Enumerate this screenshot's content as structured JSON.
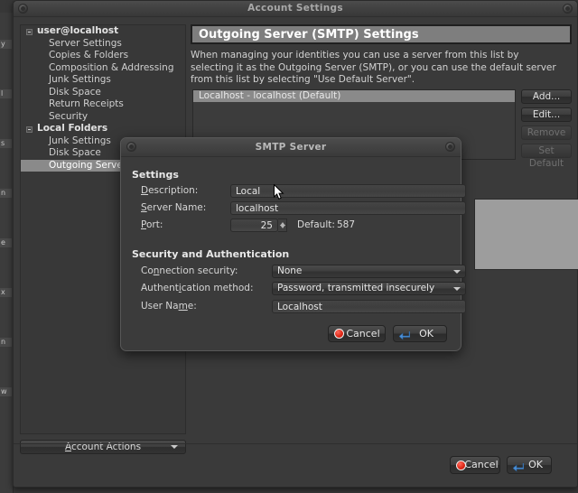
{
  "window": {
    "title": "Account Settings"
  },
  "sidebar": {
    "items": [
      {
        "label": "user@localhost",
        "level": "root",
        "selected": false,
        "twisty": true
      },
      {
        "label": "Server Settings",
        "level": "child",
        "selected": false,
        "twisty": false
      },
      {
        "label": "Copies & Folders",
        "level": "child",
        "selected": false,
        "twisty": false
      },
      {
        "label": "Composition & Addressing",
        "level": "child",
        "selected": false,
        "twisty": false
      },
      {
        "label": "Junk Settings",
        "level": "child",
        "selected": false,
        "twisty": false
      },
      {
        "label": "Disk Space",
        "level": "child",
        "selected": false,
        "twisty": false
      },
      {
        "label": "Return Receipts",
        "level": "child",
        "selected": false,
        "twisty": false
      },
      {
        "label": "Security",
        "level": "child",
        "selected": false,
        "twisty": false
      },
      {
        "label": "Local Folders",
        "level": "root",
        "selected": false,
        "twisty": true
      },
      {
        "label": "Junk Settings",
        "level": "child",
        "selected": false,
        "twisty": false
      },
      {
        "label": "Disk Space",
        "level": "child",
        "selected": false,
        "twisty": false
      },
      {
        "label": "Outgoing Server (SMTP)",
        "level": "child",
        "selected": true,
        "twisty": false
      }
    ],
    "account_actions_label": "Account Actions"
  },
  "content": {
    "pane_title": "Outgoing Server (SMTP) Settings",
    "description": "When managing your identities you can use a server from this list by selecting it as the Outgoing Server (SMTP), or you can use the default server from this list by selecting \"Use Default Server\".",
    "server_list": [
      {
        "label": "Localhost - localhost (Default)",
        "selected": true
      }
    ],
    "side_buttons": [
      {
        "label": "Add...",
        "enabled": true
      },
      {
        "label": "Edit...",
        "enabled": true
      },
      {
        "label": "Remove",
        "enabled": false
      },
      {
        "label": "Set Default",
        "enabled": false
      }
    ]
  },
  "window_buttons": {
    "cancel_label": "Cancel",
    "ok_label": "OK"
  },
  "dialog": {
    "title": "SMTP Server",
    "settings_group_label": "Settings",
    "description_label": "Description:",
    "description_value": "Local",
    "server_name_label": "Server Name:",
    "server_name_value": "localhost",
    "port_label": "Port:",
    "port_value": "25",
    "default_port_label": "Default:",
    "default_port_value": "587",
    "security_group_label": "Security and Authentication",
    "connection_security_label": "Connection security:",
    "connection_security_value": "None",
    "auth_method_label": "Authentication method:",
    "auth_method_value": "Password, transmitted insecurely",
    "user_name_label": "User Name:",
    "user_name_value": "Localhost",
    "cancel_label": "Cancel",
    "ok_label": "OK"
  },
  "background_strip": {
    "fragments": [
      "y",
      "l",
      "s",
      "n",
      "e",
      "x",
      "n",
      "w"
    ]
  },
  "colors": {
    "window_bg": "#3a3a3a",
    "header_bg": "#7e7e7e",
    "selection": "#8a8a8a",
    "text": "#d7d7d7",
    "cancel_red": "#e02a18",
    "ok_blue": "#4a90d9"
  }
}
